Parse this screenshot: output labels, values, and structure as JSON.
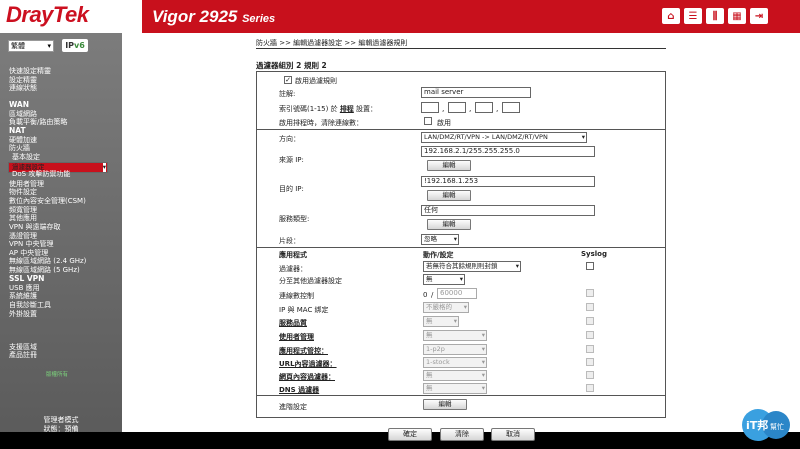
{
  "header": {
    "logo": "DrayTek",
    "model": "Vigor 2925",
    "model_suffix": "Series",
    "icons": [
      "home-icon",
      "list-icon",
      "sliders-icon",
      "grid-icon",
      "logout-icon"
    ]
  },
  "sidebar": {
    "language": "繁體",
    "ipv6_badge_ip": "IP",
    "ipv6_badge_v6": "v6",
    "items": [
      {
        "label": "快速設定精靈",
        "style": "normal"
      },
      {
        "label": "設定精靈",
        "style": "normal"
      },
      {
        "label": "連線狀態",
        "style": "normal"
      },
      {
        "label": "WAN",
        "style": "big"
      },
      {
        "label": "區域網路",
        "style": "normal"
      },
      {
        "label": "負載平衡/路由策略",
        "style": "normal"
      },
      {
        "label": "NAT",
        "style": "big"
      },
      {
        "label": "硬體加速",
        "style": "normal"
      },
      {
        "label": "防火牆",
        "style": "normal"
      },
      {
        "label": "基本設定",
        "style": "sub"
      },
      {
        "label": "過濾器設定",
        "style": "selected"
      },
      {
        "label": "DoS 攻擊防禦功能",
        "style": "sub"
      },
      {
        "label": "使用者管理",
        "style": "normal"
      },
      {
        "label": "物件設定",
        "style": "normal"
      },
      {
        "label": "數位內容安全管理(CSM)",
        "style": "normal"
      },
      {
        "label": "頻寬管理",
        "style": "normal"
      },
      {
        "label": "其他應用",
        "style": "normal"
      },
      {
        "label": "VPN 與遠端存取",
        "style": "normal"
      },
      {
        "label": "憑證管理",
        "style": "normal"
      },
      {
        "label": "VPN 中央管理",
        "style": "normal"
      },
      {
        "label": "AP 中央管理",
        "style": "normal"
      },
      {
        "label": "無線區域網路 (2.4 GHz)",
        "style": "normal"
      },
      {
        "label": "無線區域網路 (5 GHz)",
        "style": "normal"
      },
      {
        "label": "SSL VPN",
        "style": "big"
      },
      {
        "label": "USB 應用",
        "style": "normal"
      },
      {
        "label": "系統維護",
        "style": "normal"
      },
      {
        "label": "自我診斷工具",
        "style": "normal"
      },
      {
        "label": "外掛設置",
        "style": "normal"
      },
      {
        "label": "支援區域",
        "style": "normal"
      },
      {
        "label": "產品註冊",
        "style": "normal"
      }
    ],
    "copyright": "版權所有",
    "admin_mode": "管理者模式",
    "status": "狀態：預備"
  },
  "breadcrumb": "防火牆 >> 編輯過濾器設定 >> 編輯過濾器規則",
  "form": {
    "title": "過濾器組別 2 規則 2",
    "enable_rule_label": "啟用過濾規則",
    "enable_rule_checked": true,
    "comments_label": "註解:",
    "comments_value": "mail server",
    "index_label": "索引號碼(1-15) 於",
    "schedule_link": "排程",
    "index_suffix": "設置：",
    "clear_session_label": "啟用排程時，清除連線數：",
    "clear_session_option": "啟用",
    "direction_label": "方向：",
    "direction_value": "LAN/DMZ/RT/VPN -> LAN/DMZ/RT/VPN",
    "source_ip_label": "來源 IP:",
    "source_ip_value": "192.168.2.1/255.255.255.0",
    "dest_ip_label": "目的 IP:",
    "dest_ip_value": "!192.168.1.253",
    "service_type_label": "服務類型:",
    "service_type_value": "任何",
    "edit_label": "編輯",
    "fragments_label": "片段：",
    "fragments_value": "忽略",
    "col_application": "應用程式",
    "col_action": "動作/設定",
    "col_syslog": "Syslog",
    "filter_label": "過濾器：",
    "filter_value": "若無符合其餘規則則封鎖",
    "branch_label": "分至其他過濾器設定",
    "branch_value": "無",
    "max_session_label": "連線數控制",
    "max_session_current": "0",
    "max_session_total": "60000",
    "ip_mac_label": "IP 與 MAC 綁定",
    "ip_mac_value": "不嚴格的",
    "qos_label": "服務品質",
    "qos_value": "無",
    "user_mgmt_label": "使用者管理",
    "user_mgmt_value": "無",
    "app_enforcement_label": "應用程式管控：",
    "app_enforcement_value": "1-p2p",
    "url_filter_label": "URL內容過濾器：",
    "url_filter_value": "1-stock",
    "web_filter_label": "網頁內容過濾器：",
    "web_filter_value": "無",
    "dns_filter_label": "DNS 過濾器",
    "dns_filter_value": "無",
    "advance_label": "進階設定",
    "ok_label": "確定",
    "clear_label": "清除",
    "cancel_label": "取消"
  },
  "watermark": {
    "line1": "iT邦",
    "line2": "幫忙"
  }
}
